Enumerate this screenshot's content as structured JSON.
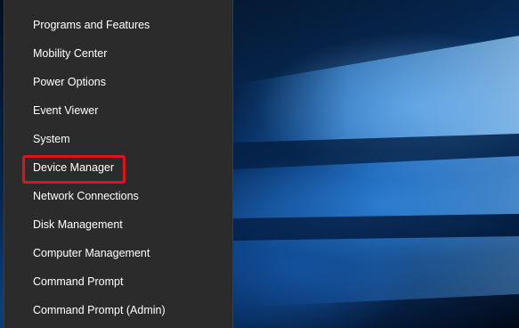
{
  "context_menu": {
    "items": [
      {
        "label": "Programs and Features"
      },
      {
        "label": "Mobility Center"
      },
      {
        "label": "Power Options"
      },
      {
        "label": "Event Viewer"
      },
      {
        "label": "System"
      },
      {
        "label": "Device Manager",
        "highlighted": true
      },
      {
        "label": "Network Connections"
      },
      {
        "label": "Disk Management"
      },
      {
        "label": "Computer Management"
      },
      {
        "label": "Command Prompt"
      },
      {
        "label": "Command Prompt (Admin)"
      }
    ],
    "highlight_color": "#e0131b",
    "background_color": "#2b2b2b"
  },
  "desktop": {
    "wallpaper": "windows-10-hero-blue"
  }
}
